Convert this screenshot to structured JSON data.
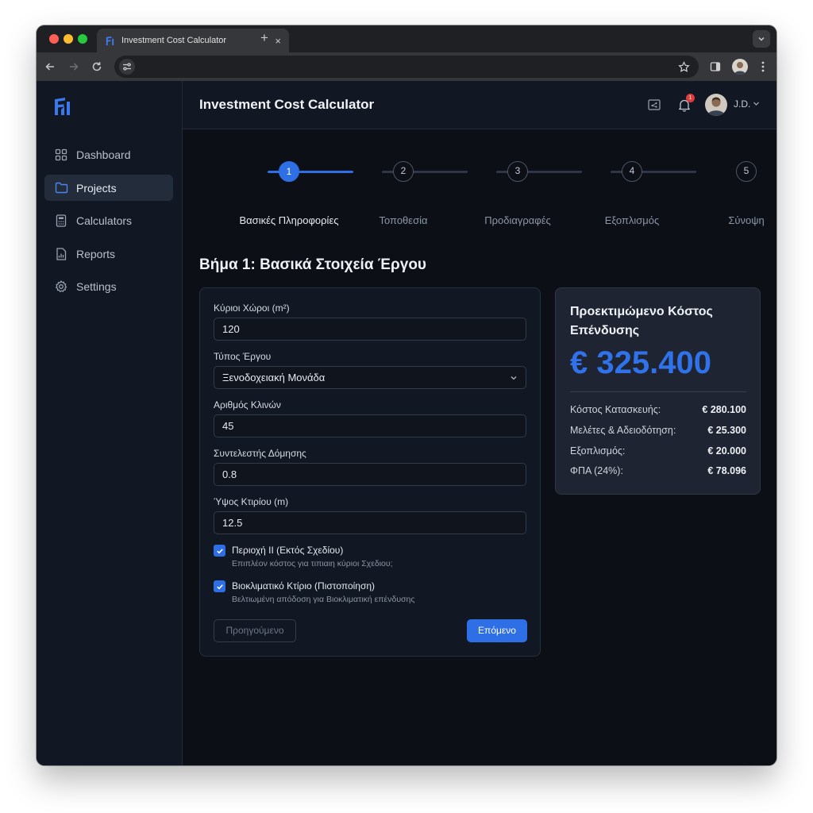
{
  "browser": {
    "tab_title": "Investment Cost Calculator",
    "tab_close": "×",
    "new_tab": "+"
  },
  "header": {
    "title": "Investment Cost Calculator",
    "notification_count": "1",
    "user_name": "J.D."
  },
  "sidebar": {
    "items": [
      {
        "label": "Dashboard",
        "icon": "grid-icon",
        "active": false
      },
      {
        "label": "Projects",
        "icon": "folder-icon",
        "active": true
      },
      {
        "label": "Calculators",
        "icon": "calculator-icon",
        "active": false
      },
      {
        "label": "Reports",
        "icon": "report-icon",
        "active": false
      },
      {
        "label": "Settings",
        "icon": "gear-icon",
        "active": false
      }
    ]
  },
  "stepper": {
    "current": 1,
    "steps": [
      {
        "number": "1",
        "label": "Βασικές Πληροφορίες"
      },
      {
        "number": "2",
        "label": "Τοποθεσία"
      },
      {
        "number": "3",
        "label": "Προδιαγραφές"
      },
      {
        "number": "4",
        "label": "Εξοπλισμός"
      },
      {
        "number": "5",
        "label": "Σύνοψη"
      }
    ]
  },
  "form": {
    "heading": "Βήμα 1: Βασικά Στοιχεία Έργου",
    "fields": [
      {
        "label": "Κύριοι Χώροι (m²)",
        "value": "120"
      },
      {
        "label": "Τύπος Έργου",
        "value": "Ξενοδοχειακή Μονάδα"
      },
      {
        "label": "Αριθμός Κλινών",
        "value": "45"
      },
      {
        "label": "Συντελεστής Δόμησης",
        "value": "0.8"
      },
      {
        "label": "Ύψος Κτιρίου (m)",
        "value": "12.5"
      }
    ],
    "checkboxes": [
      {
        "label": "Περιοχή II (Εκτός Σχεδίου)",
        "description": "Επιπλέον κόστος για τιπιαιη κύριοι Σχεδιου;",
        "checked": true
      },
      {
        "label": "Βιοκλιματικό Κτίριο (Πιστοποίηση)",
        "description": "Βελτιωμένη απόδοση για Βιοκλιματική επένδυσης",
        "checked": true
      }
    ],
    "prev_label": "Προηγούμενο",
    "next_label": "Επόμενο"
  },
  "summary": {
    "title": "Προεκτιμώμενο Κόστος Επένδυσης",
    "total": "€ 325.400",
    "breakdown": [
      {
        "label": "Κόστος Κατασκευής:",
        "value": "€ 280.100"
      },
      {
        "label": "Μελέτες & Αδειοδότηση:",
        "value": "€ 25.300"
      },
      {
        "label": "Εξοπλισμός:",
        "value": "€ 20.000"
      },
      {
        "label": "ΦΠΑ (24%):",
        "value": "€ 78.096"
      }
    ]
  },
  "colors": {
    "accent": "#2e6fe6",
    "background": "#0c0f16",
    "panel": "#121823",
    "summary_panel": "#1e2431",
    "notification": "#e23b3b"
  }
}
